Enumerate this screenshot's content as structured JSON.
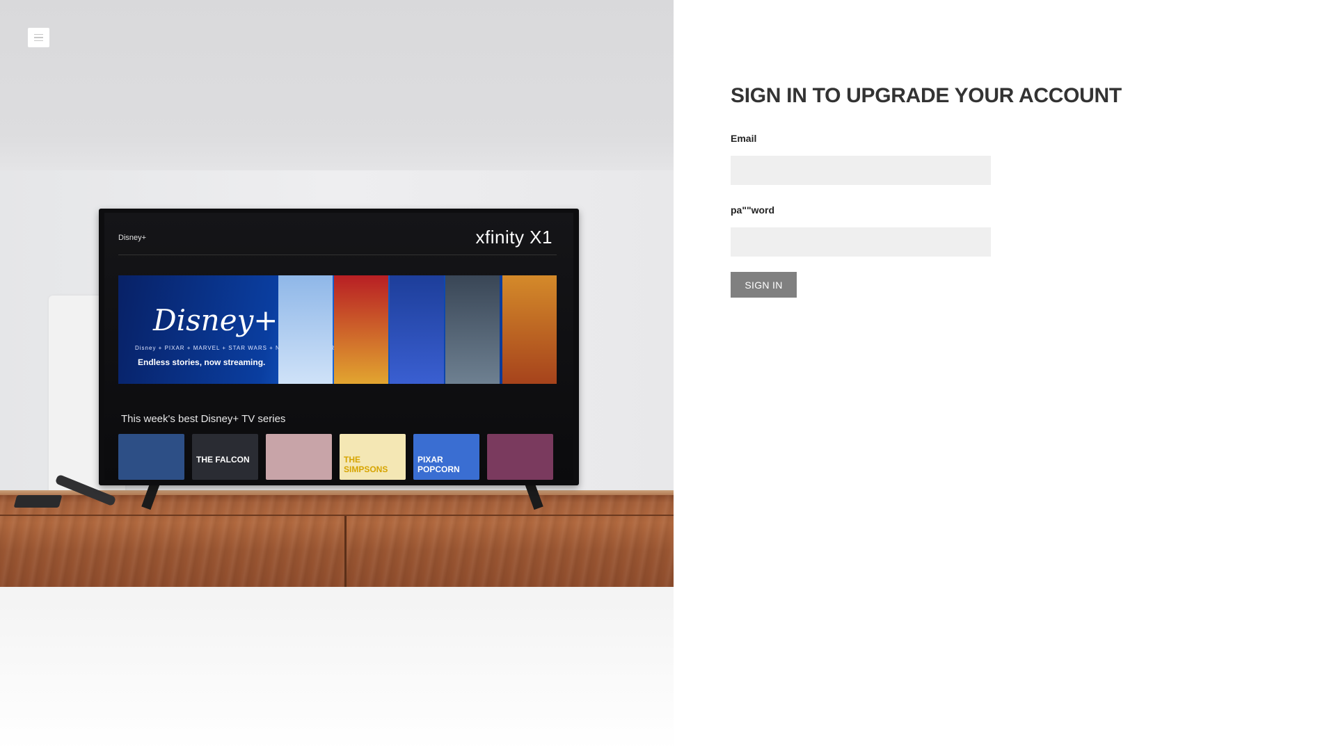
{
  "nav": {
    "menu_icon": "hamburger-menu-icon"
  },
  "hero": {
    "tv_app_name": "Disney+",
    "tv_brand": "xfinity X1",
    "banner_logo": "Disney+",
    "banner_brands": "Disney + PIXAR + MARVEL + STAR WARS + NATIONAL GEOGRAPHIC",
    "banner_tagline": "Endless stories, now streaming.",
    "row_title": "This week's best Disney+ TV series",
    "thumbnails": [
      {
        "label": "",
        "color": "#2d4f86"
      },
      {
        "label": "THE FALCON",
        "color": "#2a2c33"
      },
      {
        "label": "",
        "color": "#c8a4a8"
      },
      {
        "label": "THE SIMPSONS",
        "color": "#f4e7b4"
      },
      {
        "label": "PIXAR POPCORN",
        "color": "#3a6ed2"
      },
      {
        "label": "",
        "color": "#7a3a5e"
      }
    ]
  },
  "form": {
    "title": "SIGN IN TO UPGRADE YOUR ACCOUNT",
    "email_label": "Email",
    "email_value": "",
    "password_label": "pa\"\"word",
    "password_value": "",
    "submit_label": "SIGN IN"
  },
  "colors": {
    "title": "#333333",
    "input_bg": "#efefef",
    "button_bg": "#808080",
    "button_text": "#ffffff"
  }
}
